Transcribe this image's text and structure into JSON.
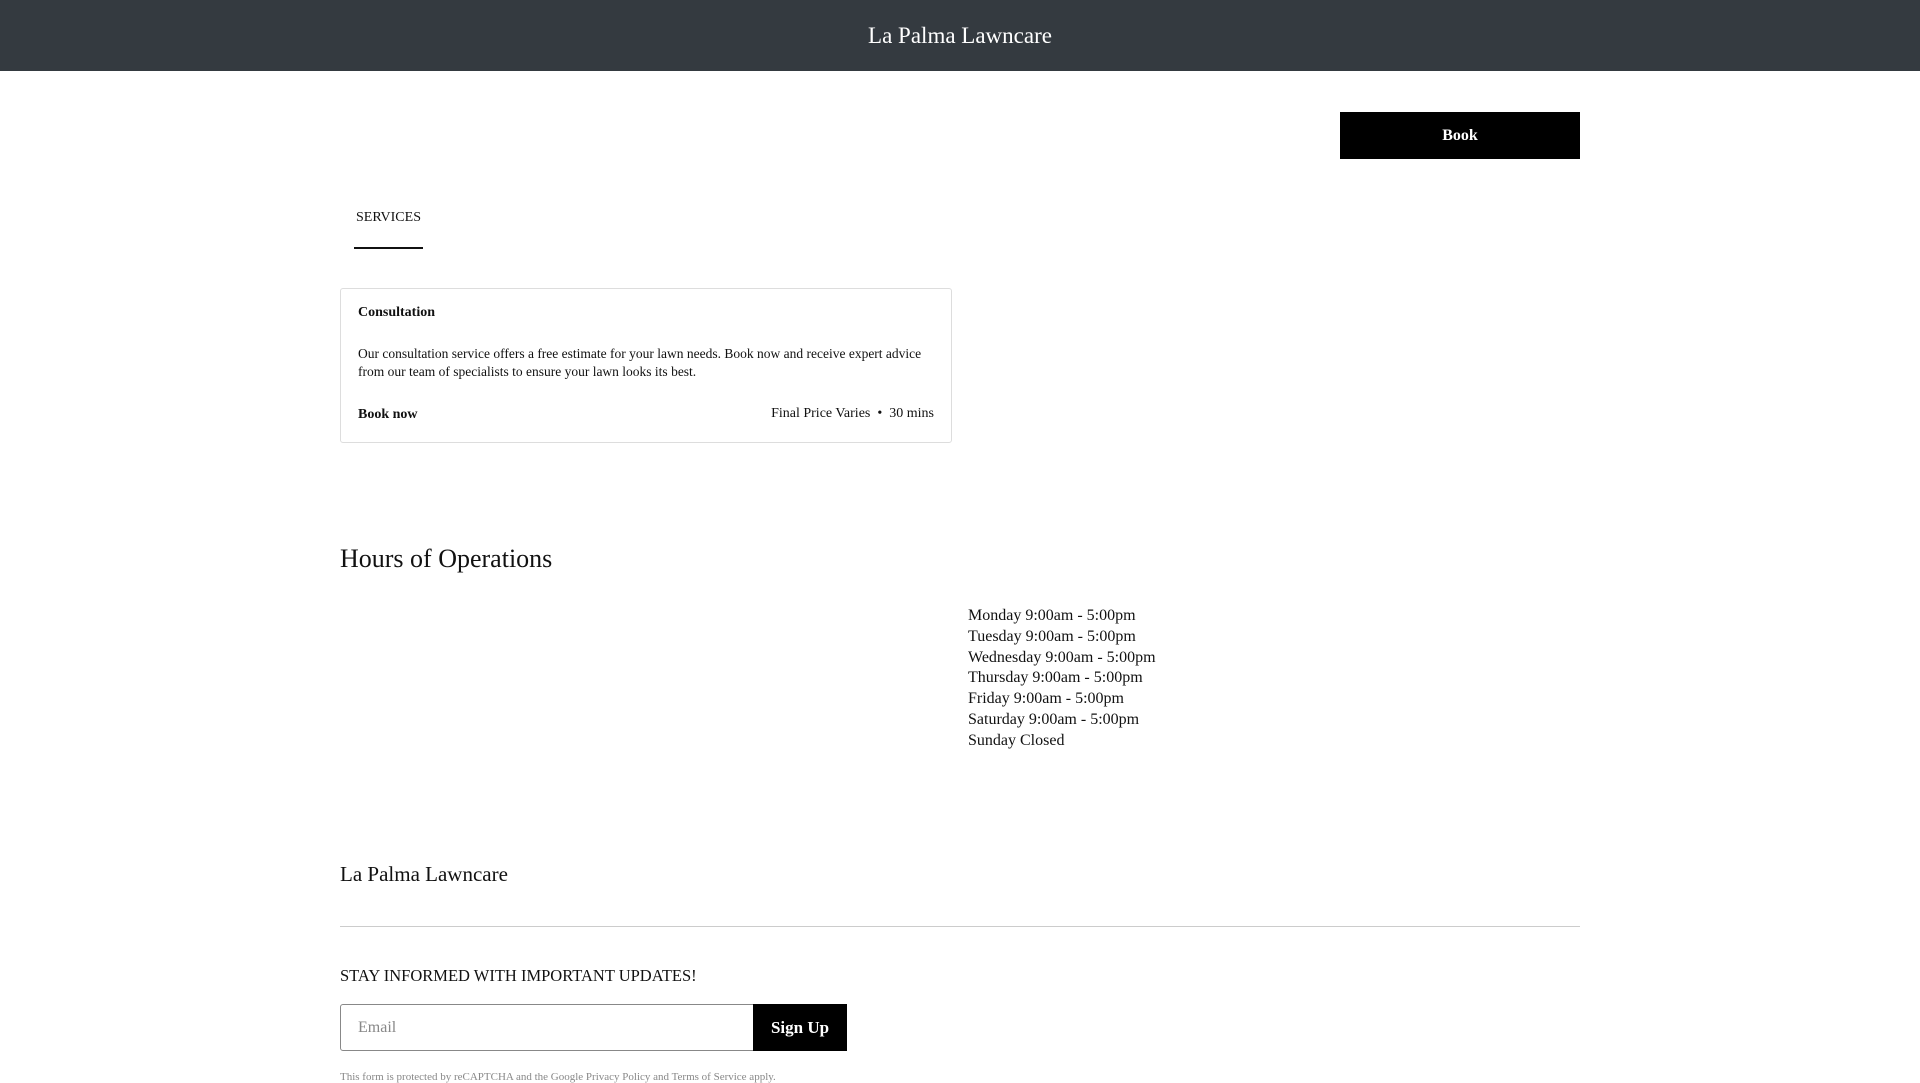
{
  "header": {
    "title": "La Palma Lawncare"
  },
  "actions": {
    "book_label": "Book"
  },
  "tabs": [
    {
      "label": "SERVICES"
    }
  ],
  "service": {
    "title": "Consultation",
    "description": "Our consultation service offers a free estimate for your lawn needs. Book now and receive expert advice from our team of specialists to ensure your lawn looks its best.",
    "book_label": "Book now",
    "price": "Final Price Varies",
    "separator": "•",
    "duration": "30 mins"
  },
  "hours": {
    "heading": "Hours of Operations",
    "days": [
      "Monday 9:00am - 5:00pm",
      "Tuesday 9:00am - 5:00pm",
      "Wednesday 9:00am - 5:00pm",
      "Thursday 9:00am - 5:00pm",
      "Friday 9:00am - 5:00pm",
      "Saturday 9:00am - 5:00pm",
      "Sunday Closed"
    ]
  },
  "footer": {
    "business_name": "La Palma Lawncare",
    "newsletter_heading": "STAY INFORMED WITH IMPORTANT UPDATES!",
    "email_placeholder": "Email",
    "signup_label": "Sign Up",
    "legal": "This form is protected by reCAPTCHA and the Google Privacy Policy and Terms of Service apply."
  }
}
